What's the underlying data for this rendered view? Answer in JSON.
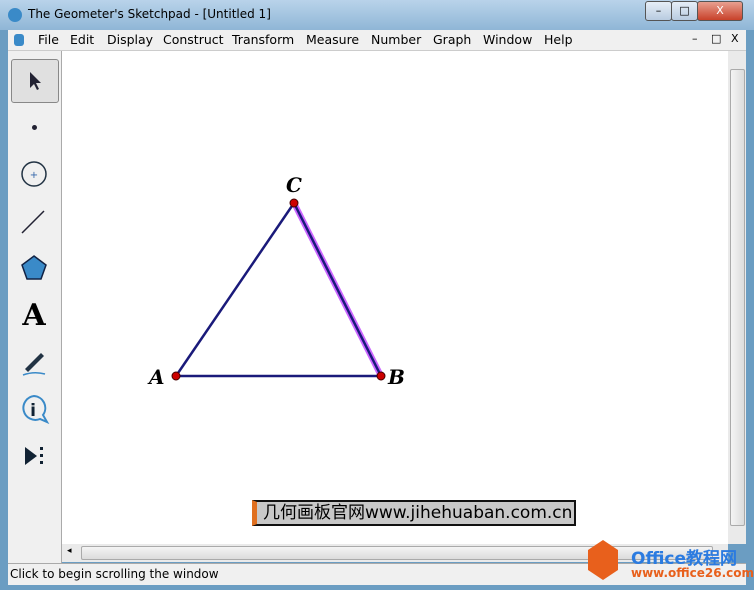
{
  "window": {
    "title": "The Geometer's Sketchpad - [Untitled 1]",
    "min": "–",
    "max": "□",
    "close": "X"
  },
  "menu": [
    "File",
    "Edit",
    "Display",
    "Construct",
    "Transform",
    "Measure",
    "Number",
    "Graph",
    "Window",
    "Help"
  ],
  "tools": [
    "arrow-tool",
    "point-tool",
    "compass-tool",
    "straightedge-tool",
    "polygon-tool",
    "text-tool",
    "marker-tool",
    "information-tool",
    "custom-tool"
  ],
  "text_tool_label": "A",
  "points": {
    "a": "A",
    "b": "B",
    "c": "C"
  },
  "caption": "几何画板官网www.jihehuaban.com.cn",
  "status": "Click to begin scrolling the window",
  "watermark": {
    "brand": "Office教程网",
    "url": "www.office26.com"
  },
  "colors": {
    "segment": "#1a1a7a",
    "point": "#cc0000",
    "selection": "#cc66ff"
  }
}
